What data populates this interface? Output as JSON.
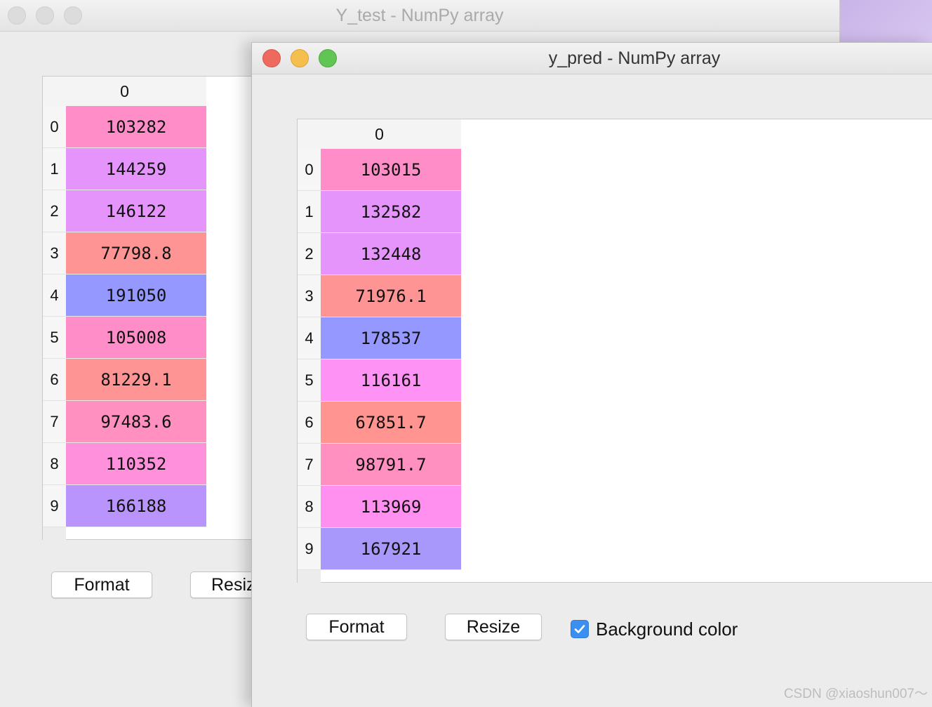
{
  "back_window": {
    "title": "Y_test - NumPy array",
    "column_header": "0",
    "rows": [
      {
        "index": "0",
        "value": "103282",
        "color": "#ff8ec8"
      },
      {
        "index": "1",
        "value": "144259",
        "color": "#e594fb"
      },
      {
        "index": "2",
        "value": "146122",
        "color": "#e594fb"
      },
      {
        "index": "3",
        "value": "77798.8",
        "color": "#ff9494"
      },
      {
        "index": "4",
        "value": "191050",
        "color": "#9498ff"
      },
      {
        "index": "5",
        "value": "105008",
        "color": "#ff8ec8"
      },
      {
        "index": "6",
        "value": "81229.1",
        "color": "#ff9494"
      },
      {
        "index": "7",
        "value": "97483.6",
        "color": "#ff90bf"
      },
      {
        "index": "8",
        "value": "110352",
        "color": "#ff90db"
      },
      {
        "index": "9",
        "value": "166188",
        "color": "#b894fc"
      }
    ],
    "format_label": "Format",
    "resize_label": "Resize"
  },
  "front_window": {
    "title": "y_pred - NumPy array",
    "column_header": "0",
    "rows": [
      {
        "index": "0",
        "value": "103015",
        "color": "#ff8ec8"
      },
      {
        "index": "1",
        "value": "132582",
        "color": "#e594fb"
      },
      {
        "index": "2",
        "value": "132448",
        "color": "#e594fb"
      },
      {
        "index": "3",
        "value": "71976.1",
        "color": "#ff9494"
      },
      {
        "index": "4",
        "value": "178537",
        "color": "#9498ff"
      },
      {
        "index": "5",
        "value": "116161",
        "color": "#ff92f5"
      },
      {
        "index": "6",
        "value": "67851.7",
        "color": "#ff9490"
      },
      {
        "index": "7",
        "value": "98791.7",
        "color": "#ff90bf"
      },
      {
        "index": "8",
        "value": "113969",
        "color": "#ff90f0"
      },
      {
        "index": "9",
        "value": "167921",
        "color": "#a998fc"
      }
    ],
    "format_label": "Format",
    "resize_label": "Resize",
    "background_color_label": "Background color",
    "background_color_checked": true
  },
  "watermark": "CSDN @xiaoshun007～"
}
